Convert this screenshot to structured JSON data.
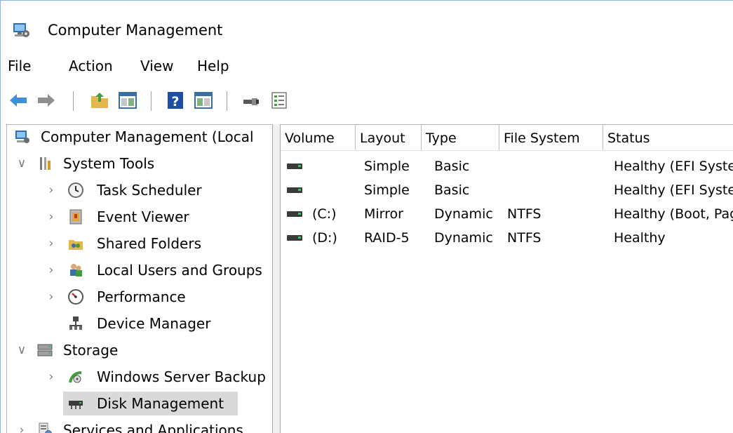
{
  "window": {
    "title": "Computer Management"
  },
  "menu": [
    "File",
    "Action",
    "View",
    "Help"
  ],
  "toolbar": {
    "icons": [
      "back-arrow-icon",
      "forward-arrow-icon",
      "up-folder-icon",
      "show-hide-tree-icon",
      "help-icon",
      "show-hide-action-pane-icon",
      "connect-icon",
      "properties-icon"
    ]
  },
  "tree": [
    {
      "label": "Computer Management (Local",
      "icon": "computer-management-icon",
      "chevron": "",
      "selected": false
    },
    {
      "label": "System Tools",
      "icon": "system-tools-icon",
      "chevron": "expanded",
      "selected": false
    },
    {
      "label": "Task Scheduler",
      "icon": "clock-icon",
      "chevron": "collapsed",
      "selected": false
    },
    {
      "label": "Event Viewer",
      "icon": "event-viewer-icon",
      "chevron": "collapsed",
      "selected": false
    },
    {
      "label": "Shared Folders",
      "icon": "shared-folders-icon",
      "chevron": "collapsed",
      "selected": false
    },
    {
      "label": "Local Users and Groups",
      "icon": "users-icon",
      "chevron": "collapsed",
      "selected": false
    },
    {
      "label": "Performance",
      "icon": "performance-gauge-icon",
      "chevron": "collapsed",
      "selected": false
    },
    {
      "label": "Device Manager",
      "icon": "device-manager-icon",
      "chevron": "",
      "selected": false
    },
    {
      "label": "Storage",
      "icon": "storage-icon",
      "chevron": "expanded",
      "selected": false
    },
    {
      "label": "Windows Server Backup",
      "icon": "server-backup-icon",
      "chevron": "collapsed",
      "selected": false
    },
    {
      "label": "Disk Management",
      "icon": "disk-management-icon",
      "chevron": "",
      "selected": true
    },
    {
      "label": "Services and Applications",
      "icon": "services-icon",
      "chevron": "collapsed",
      "selected": false
    }
  ],
  "table": {
    "columns": [
      "Volume",
      "Layout",
      "Type",
      "File System",
      "Status"
    ],
    "rows": [
      {
        "volume": "",
        "layout": "Simple",
        "type": "Basic",
        "fs": "",
        "status": "Healthy (EFI System Partition)"
      },
      {
        "volume": "",
        "layout": "Simple",
        "type": "Basic",
        "fs": "",
        "status": "Healthy (EFI System Partition)"
      },
      {
        "volume": "(C:)",
        "layout": "Mirror",
        "type": "Dynamic",
        "fs": "NTFS",
        "status": "Healthy (Boot, Page File)"
      },
      {
        "volume": "(D:)",
        "layout": "RAID-5",
        "type": "Dynamic",
        "fs": "NTFS",
        "status": "Healthy"
      }
    ]
  },
  "colors": {
    "back_arrow": "#3f8fd8",
    "forward_arrow": "#8f8f8f",
    "selection": "#d9d9d9",
    "window_border": "#8fb3d9"
  }
}
